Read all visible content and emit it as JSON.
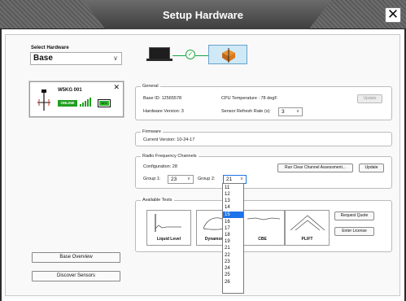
{
  "window": {
    "title": "Setup Hardware"
  },
  "left_panel": {
    "select_label": "Select Hardware",
    "selected_hardware": "Base",
    "base_card": {
      "name": "W5KG 001",
      "status": "ONLINE",
      "battery_label": "84%"
    },
    "buttons": {
      "overview": "Base Overview",
      "discover": "Discover Sensors"
    }
  },
  "general": {
    "legend": "General",
    "base_id": "Base ID: 12565578",
    "cpu_temp": "CPU Temperature : 78 degF",
    "hardware_version": "Hardware Version: 3",
    "refresh_label": "Sensor Refresh Rate (s):",
    "refresh_value": "3",
    "update_button": "Update"
  },
  "firmware": {
    "legend": "Firmware",
    "current_version": "Current Version: 10-24-17"
  },
  "rf": {
    "legend": "Radio Frequency Channels",
    "configuration": "Configuration: 28",
    "clear_channel_button": "Run Clear Channel Assessment...",
    "update_button": "Update",
    "group1_label": "Group 1:",
    "group1_value": "23",
    "group2_label": "Group 2:",
    "group2_value": "21"
  },
  "tests": {
    "legend": "Available Tests",
    "items": [
      "Liquid Level",
      "Dynamometer",
      "CBE",
      "PLIFT"
    ],
    "request_quote_button": "Request Quote",
    "enter_license_button": "Enter License"
  },
  "dropdown": {
    "options": [
      "11",
      "12",
      "13",
      "14",
      "15",
      "16",
      "17",
      "18",
      "19",
      "21",
      "22",
      "23",
      "24",
      "25",
      "26"
    ],
    "highlighted": "15"
  },
  "colors": {
    "online_green": "#1f9e1f",
    "highlight_blue": "#1e73e8",
    "title_bar": "#4a4a4a"
  }
}
